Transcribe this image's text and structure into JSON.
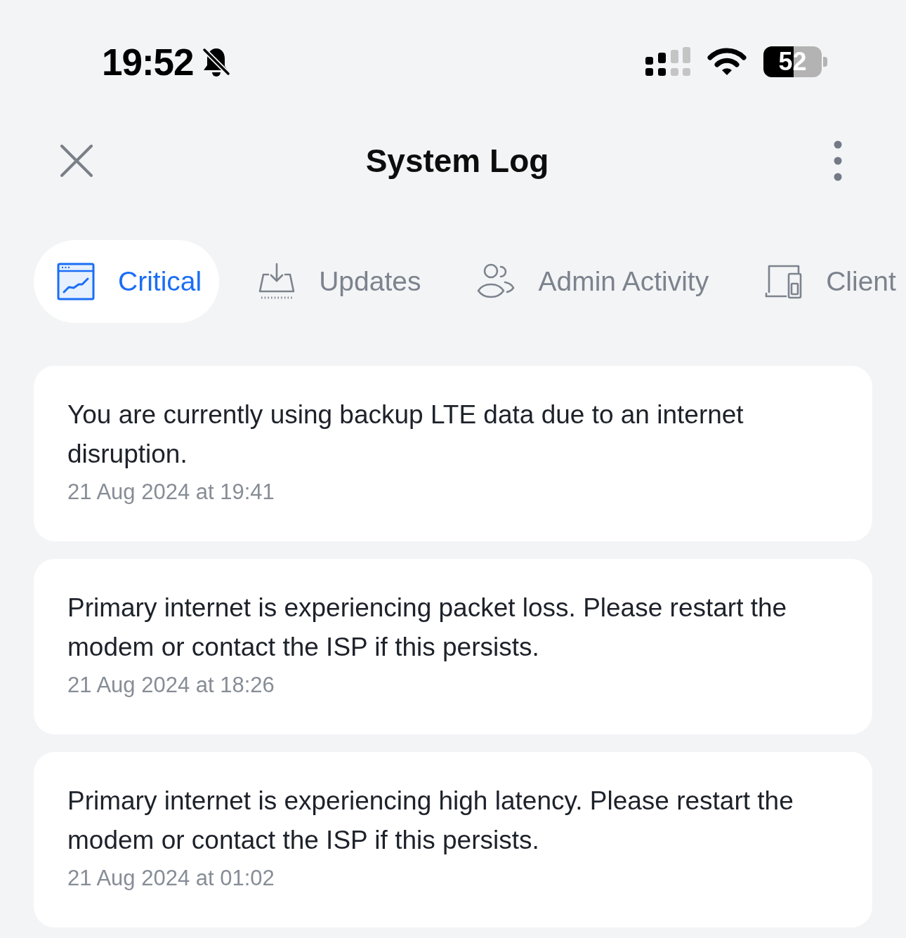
{
  "status_bar": {
    "time": "19:52",
    "silent": true,
    "battery": "52"
  },
  "header": {
    "title": "System Log"
  },
  "tabs": [
    {
      "label": "Critical",
      "selected": true,
      "kind": "chart"
    },
    {
      "label": "Updates",
      "selected": false,
      "kind": "download"
    },
    {
      "label": "Admin Activity",
      "selected": false,
      "kind": "users"
    },
    {
      "label": "Client",
      "selected": false,
      "kind": "devices"
    }
  ],
  "entries": [
    {
      "message": "You are currently using backup LTE data due to an internet disruption.",
      "time": "21 Aug 2024 at 19:41"
    },
    {
      "message": "Primary internet is experiencing packet loss. Please restart the modem or contact the ISP if this persists.",
      "time": "21 Aug 2024 at 18:26"
    },
    {
      "message": "Primary internet is experiencing high latency. Please restart the modem or contact the ISP if this persists.",
      "time": "21 Aug 2024 at 01:02"
    }
  ]
}
